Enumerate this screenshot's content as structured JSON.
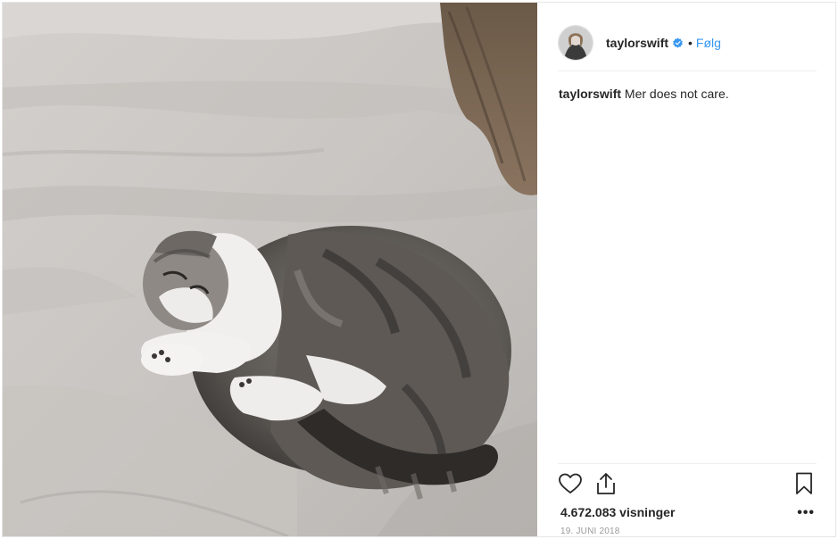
{
  "post": {
    "media_alt": "Gray tabby and white Scottish Fold cat curled up asleep on a light gray duvet",
    "header": {
      "username": "taylorswift",
      "verified_icon": "verified-badge-icon",
      "separator": "•",
      "follow_label": "Følg"
    },
    "caption": {
      "username": "taylorswift",
      "text": "Mer does not care."
    },
    "actions": {
      "like_icon": "heart-icon",
      "share_icon": "share-icon",
      "save_icon": "bookmark-icon",
      "more_icon": "more-options-icon",
      "more_label": "•••"
    },
    "views": "4.672.083 visninger",
    "date": "19. JUNI 2018"
  },
  "colors": {
    "link": "#3897f0",
    "verified": "#3897f0",
    "text": "#262626",
    "muted": "#999999"
  }
}
